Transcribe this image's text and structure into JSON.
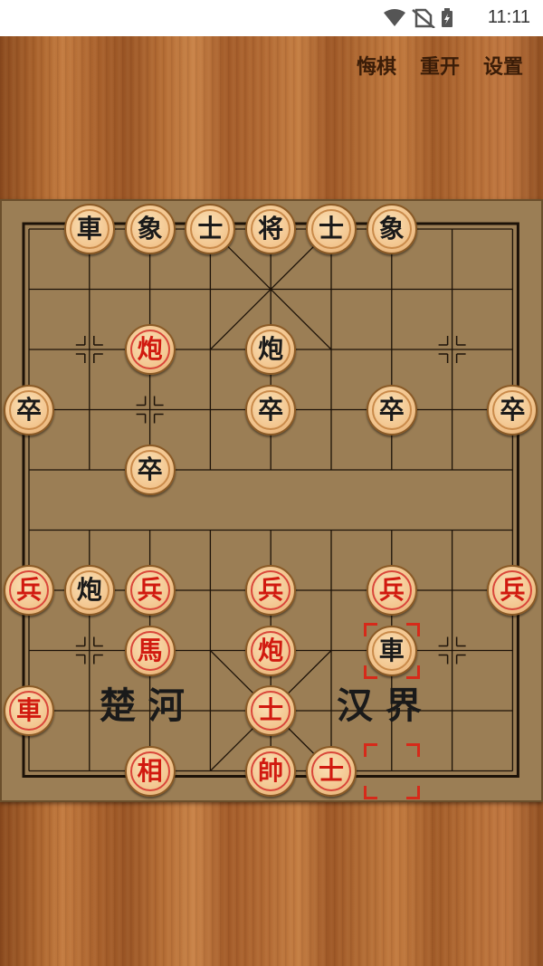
{
  "status_bar": {
    "time": "11:11",
    "icons": [
      "wifi-icon",
      "no-sim-icon",
      "battery-charging-icon"
    ]
  },
  "menu": {
    "undo": "悔棋",
    "restart": "重开",
    "settings": "设置"
  },
  "river": {
    "left": "楚 河",
    "right": "汉 界"
  },
  "pieces": [
    {
      "col": 1,
      "row": 0,
      "char": "車",
      "side": "black"
    },
    {
      "col": 2,
      "row": 0,
      "char": "象",
      "side": "black"
    },
    {
      "col": 3,
      "row": 0,
      "char": "士",
      "side": "black"
    },
    {
      "col": 4,
      "row": 0,
      "char": "将",
      "side": "black"
    },
    {
      "col": 5,
      "row": 0,
      "char": "士",
      "side": "black"
    },
    {
      "col": 6,
      "row": 0,
      "char": "象",
      "side": "black"
    },
    {
      "col": 2,
      "row": 2,
      "char": "炮",
      "side": "red"
    },
    {
      "col": 4,
      "row": 2,
      "char": "炮",
      "side": "black"
    },
    {
      "col": 0,
      "row": 3,
      "char": "卒",
      "side": "black"
    },
    {
      "col": 4,
      "row": 3,
      "char": "卒",
      "side": "black"
    },
    {
      "col": 6,
      "row": 3,
      "char": "卒",
      "side": "black"
    },
    {
      "col": 8,
      "row": 3,
      "char": "卒",
      "side": "black"
    },
    {
      "col": 2,
      "row": 4,
      "char": "卒",
      "side": "black"
    },
    {
      "col": 0,
      "row": 6,
      "char": "兵",
      "side": "red"
    },
    {
      "col": 1,
      "row": 6,
      "char": "炮",
      "side": "black"
    },
    {
      "col": 2,
      "row": 6,
      "char": "兵",
      "side": "red"
    },
    {
      "col": 4,
      "row": 6,
      "char": "兵",
      "side": "red"
    },
    {
      "col": 6,
      "row": 6,
      "char": "兵",
      "side": "red"
    },
    {
      "col": 8,
      "row": 6,
      "char": "兵",
      "side": "red"
    },
    {
      "col": 2,
      "row": 7,
      "char": "馬",
      "side": "red"
    },
    {
      "col": 4,
      "row": 7,
      "char": "炮",
      "side": "red"
    },
    {
      "col": 6,
      "row": 7,
      "char": "車",
      "side": "black"
    },
    {
      "col": 0,
      "row": 8,
      "char": "車",
      "side": "red"
    },
    {
      "col": 4,
      "row": 8,
      "char": "士",
      "side": "red"
    },
    {
      "col": 2,
      "row": 9,
      "char": "相",
      "side": "red"
    },
    {
      "col": 4,
      "row": 9,
      "char": "帥",
      "side": "red"
    },
    {
      "col": 5,
      "row": 9,
      "char": "士",
      "side": "red"
    }
  ],
  "last_move": {
    "from": {
      "col": 6,
      "row": 9
    },
    "to": {
      "col": 6,
      "row": 7
    }
  }
}
